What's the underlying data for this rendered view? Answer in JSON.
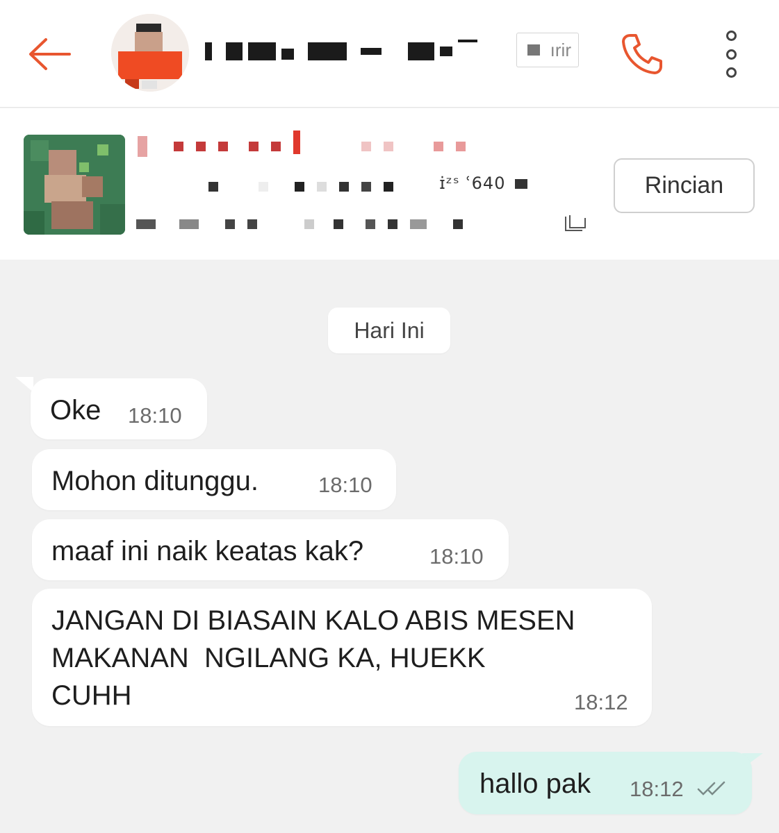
{
  "header": {
    "contact_name": "",
    "tag_text": "ırir",
    "icons": {
      "back": "arrow-left-icon",
      "call": "phone-icon",
      "more": "more-vertical-icon"
    },
    "accent_color": "#e8562f"
  },
  "order": {
    "details_label": "Rincian",
    "partial_text": "ɪ̄ɪ̇ɪ̈́ ɪ̇ɪ̈́ɪ̇ɪ̈́ɪ̇ɪ̈́ ɪ̇ɪ̈́ɪ̇ɪ̈́ 640",
    "icons": {
      "copy": "copy-icon"
    }
  },
  "chat": {
    "date_label": "Hari Ini",
    "messages": [
      {
        "direction": "in",
        "text": "Oke",
        "time": "18:10"
      },
      {
        "direction": "in",
        "text": "Mohon ditunggu.",
        "time": "18:10"
      },
      {
        "direction": "in",
        "text": "maaf ini naik keatas kak?",
        "time": "18:10"
      },
      {
        "direction": "in",
        "text": [
          "JANGAN DI BIASAIN KALO ABIS MESEN",
          "MAKANAN  NGILANG KA, HUEKK",
          "CUHH"
        ],
        "time": "18:12"
      },
      {
        "direction": "out",
        "text": "hallo pak",
        "time": "18:12",
        "status": "read-double-check-icon"
      }
    ],
    "outgoing_color": "#d8f4ee",
    "incoming_color": "#ffffff"
  }
}
